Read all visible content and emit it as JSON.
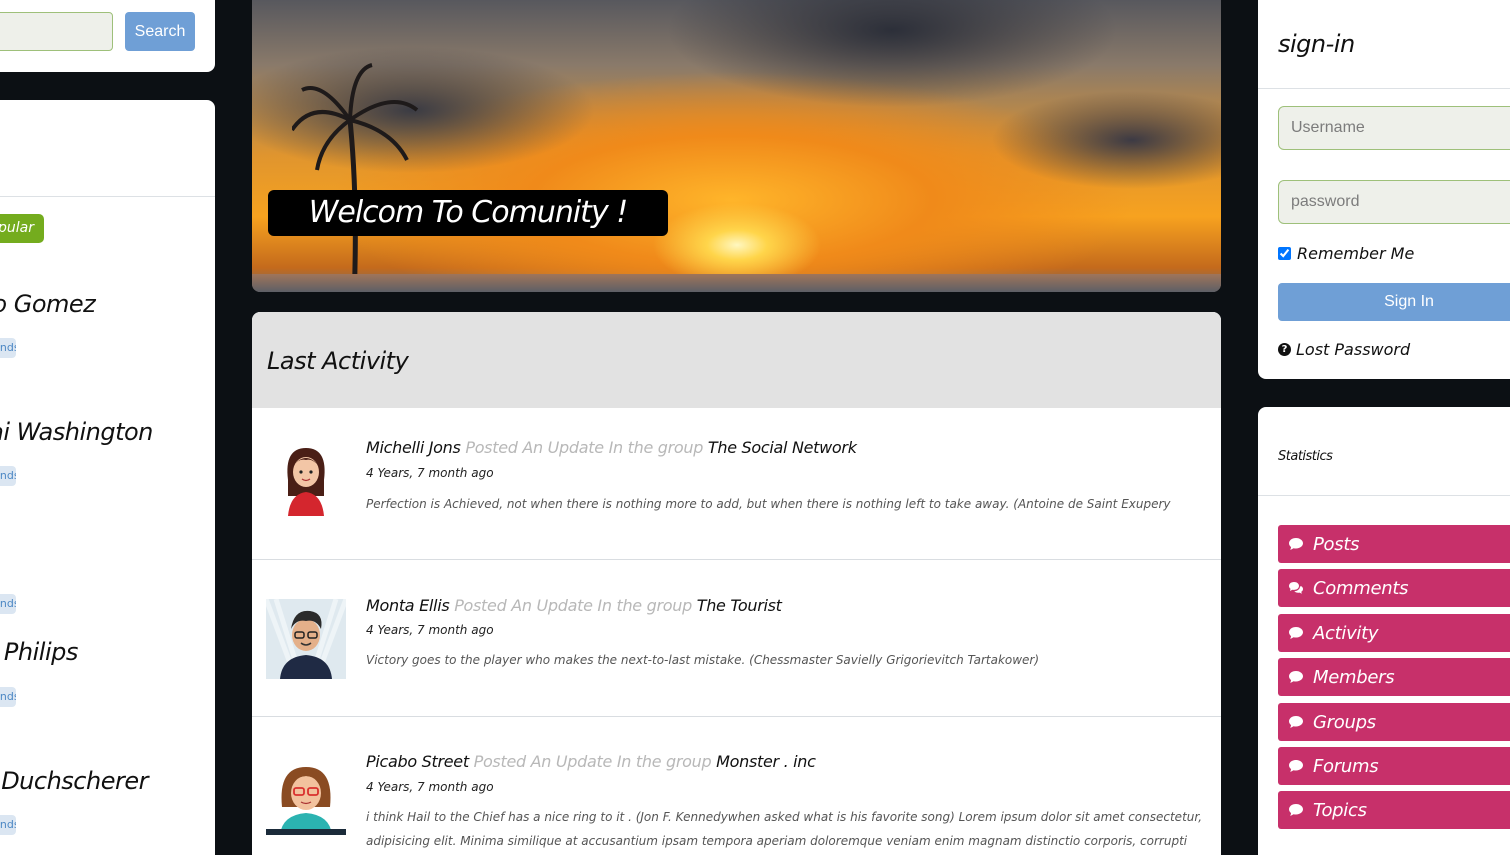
{
  "search": {
    "placeholder": "",
    "button_label": "Search"
  },
  "left_panel": {
    "popular_tab": "Popular",
    "members": [
      {
        "name": "Eduardo Gomez",
        "tag": "Friends"
      },
      {
        "name": "Ameerah Kai Washington",
        "tag": "Friends"
      },
      {
        "name": "",
        "tag": "Friends"
      },
      {
        "name": "Deshanna Philips",
        "tag": "Friends"
      },
      {
        "name": "Andy Duchscherer",
        "tag": "Friends"
      }
    ]
  },
  "hero": {
    "welcome": "Welcom To Comunity !"
  },
  "activity": {
    "title": "Last Activity",
    "items": [
      {
        "user": "Michelli Jons",
        "verb": "Posted An Update In the group",
        "group": "The Social Network",
        "time": "4 Years, 7 month ago",
        "text": "Perfection is Achieved, not when there is nothing more to add, but when there is nothing left to take away. (Antoine de Saint Exupery"
      },
      {
        "user": "Monta Ellis",
        "verb": "Posted An Update In the group",
        "group": "The Tourist",
        "time": "4 Years, 7 month ago",
        "text": "Victory goes to the player who makes the next-to-last mistake. (Chessmaster Savielly Grigorievitch Tartakower)"
      },
      {
        "user": "Picabo Street",
        "verb": "Posted An Update In the group",
        "group": "Monster . inc",
        "time": "4 Years, 7 month ago",
        "text": "i think Hail to the Chief has a nice ring to it . (Jon F. Kennedywhen asked what is his favorite song) Lorem ipsum dolor sit amet consectetur, adipisicing elit. Minima similique at accusantium ipsam tempora aperiam doloremque veniam enim magnam distinctio corporis, corrupti quam dolorem, cum nobis"
      }
    ]
  },
  "signin": {
    "title": "sign-in",
    "username_placeholder": "Username",
    "password_placeholder": "password",
    "remember_label": "Remember Me",
    "remember_checked": true,
    "button_label": "Sign In",
    "lost_password": "Lost Password"
  },
  "statistics": {
    "title": "Statistics",
    "items": [
      "Posts",
      "Comments",
      "Activity",
      "Members",
      "Groups",
      "Forums",
      "Topics"
    ]
  },
  "colors": {
    "accent_blue": "#6f9fd6",
    "stat_pink": "#c7306a",
    "popular_green": "#74ac1e",
    "page_bg": "#0c1014"
  }
}
